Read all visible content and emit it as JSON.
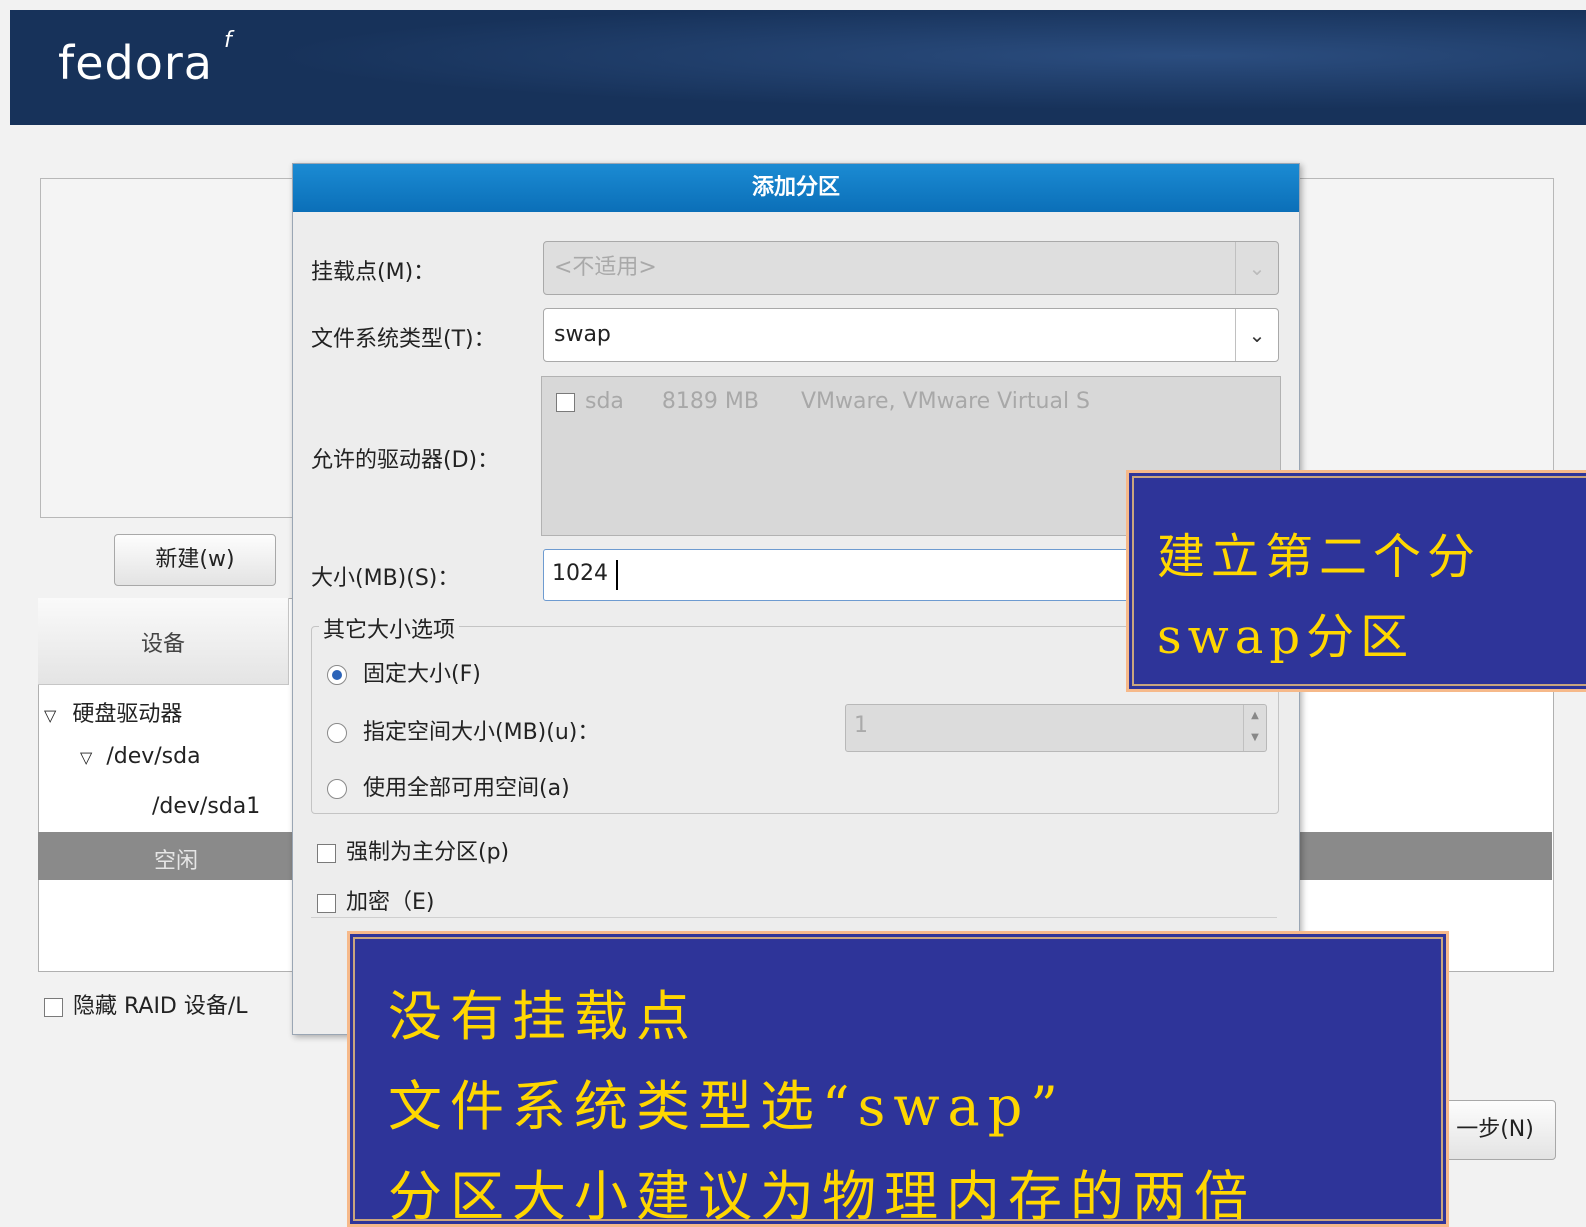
{
  "brand": {
    "logo_text": "fedora",
    "logo_mark": "f"
  },
  "main": {
    "new_button": "新建(w)",
    "tree_header": "设备",
    "tree": [
      "硬盘驱动器",
      "/dev/sda",
      "/dev/sda1",
      "空闲"
    ],
    "hide_raid": "隐藏 RAID 设备/L",
    "next_button": "一步(N)"
  },
  "dialog": {
    "title": "添加分区",
    "mount_label": "挂载点(M)：",
    "mount_value": "<不适用>",
    "fstype_label": "文件系统类型(T)：",
    "fstype_value": "swap",
    "drives_label": "允许的驱动器(D)：",
    "drive": {
      "name": "sda",
      "size": "8189 MB",
      "model": "VMware, VMware Virtual S"
    },
    "size_label": "大小(MB)(S)：",
    "size_value": "1024",
    "other_size_legend": "其它大小选项",
    "opt_fixed": "固定大小(F)",
    "opt_upto": "指定空间大小(MB)(u)：",
    "opt_upto_value": "1",
    "opt_fill": "使用全部可用空间(a)",
    "force_primary": "强制为主分区(p)",
    "encrypt": "加密（E)"
  },
  "notes": {
    "note1_line1": "建立第二个分",
    "note1_line2": "swap分区",
    "note2_line1": "没有挂载点",
    "note2_line2": "文件系统类型选“swap”",
    "note2_line3": "分区大小建议为物理内存的两倍"
  }
}
